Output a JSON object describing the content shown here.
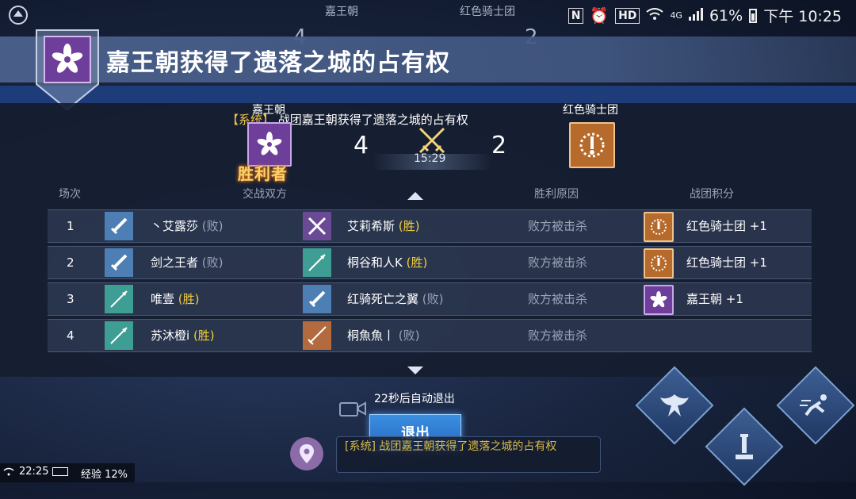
{
  "status_bar": {
    "time": "下午 10:25",
    "battery": "61%",
    "network": "4G",
    "hd_label": "HD",
    "n_label": "N"
  },
  "top_header": {
    "left_team": "嘉王朝",
    "right_team": "红色骑士团",
    "left_score": "4",
    "right_score": "2"
  },
  "banner": {
    "title": "嘉王朝获得了遗落之城的占有权"
  },
  "score": {
    "left_team": "嘉王朝",
    "right_team": "红色骑士团",
    "left_score": "4",
    "right_score": "2",
    "timer": "15:29",
    "system_tag": "【系统】",
    "system_message": "战团嘉王朝获得了遗落之城的占有权",
    "winner_label": "胜利者"
  },
  "table": {
    "headers": {
      "round": "场次",
      "combatants": "交战双方",
      "reason": "胜利原因",
      "points": "战团积分"
    },
    "rows": [
      {
        "round": "1",
        "p1": "丶艾露莎",
        "p1_result": "(败)",
        "p2": "艾莉希斯",
        "p2_result": "(胜)",
        "reason": "败方被击杀",
        "guild_points": "红色骑士团 +1"
      },
      {
        "round": "2",
        "p1": "剑之王者",
        "p1_result": "(败)",
        "p2": "桐谷和人K",
        "p2_result": "(胜)",
        "reason": "败方被击杀",
        "guild_points": "红色骑士团 +1"
      },
      {
        "round": "3",
        "p1": "唯壹",
        "p1_result": "(胜)",
        "p2": "红骑死亡之翼",
        "p2_result": "(败)",
        "reason": "败方被击杀",
        "guild_points": "嘉王朝 +1"
      },
      {
        "round": "4",
        "p1": "苏沐橙i",
        "p1_result": "(胜)",
        "p2": "桐魚魚丨",
        "p2_result": "(败)",
        "reason": "败方被击杀",
        "guild_points": ""
      }
    ]
  },
  "footer": {
    "auto_exit": "22秒后自动退出",
    "exit_button": "退出",
    "chat_message": "[系统] 战团嘉王朝获得了遗落之城的占有权",
    "clock": "22:25",
    "exp": "经验 12%"
  },
  "colors": {
    "purple_guild": "#6d3f9b",
    "orange_guild": "#b66a2c",
    "win_text": "#f3cf3b",
    "exit_button": "#2f7fd4"
  },
  "icons": [
    "flower-emblem-icon",
    "sun-sword-emblem-icon",
    "crossed-swords-icon",
    "sword-icon",
    "map-pin-icon",
    "camera-icon",
    "phoenix-skill-icon",
    "dash-skill-icon",
    "tower-skill-icon"
  ]
}
